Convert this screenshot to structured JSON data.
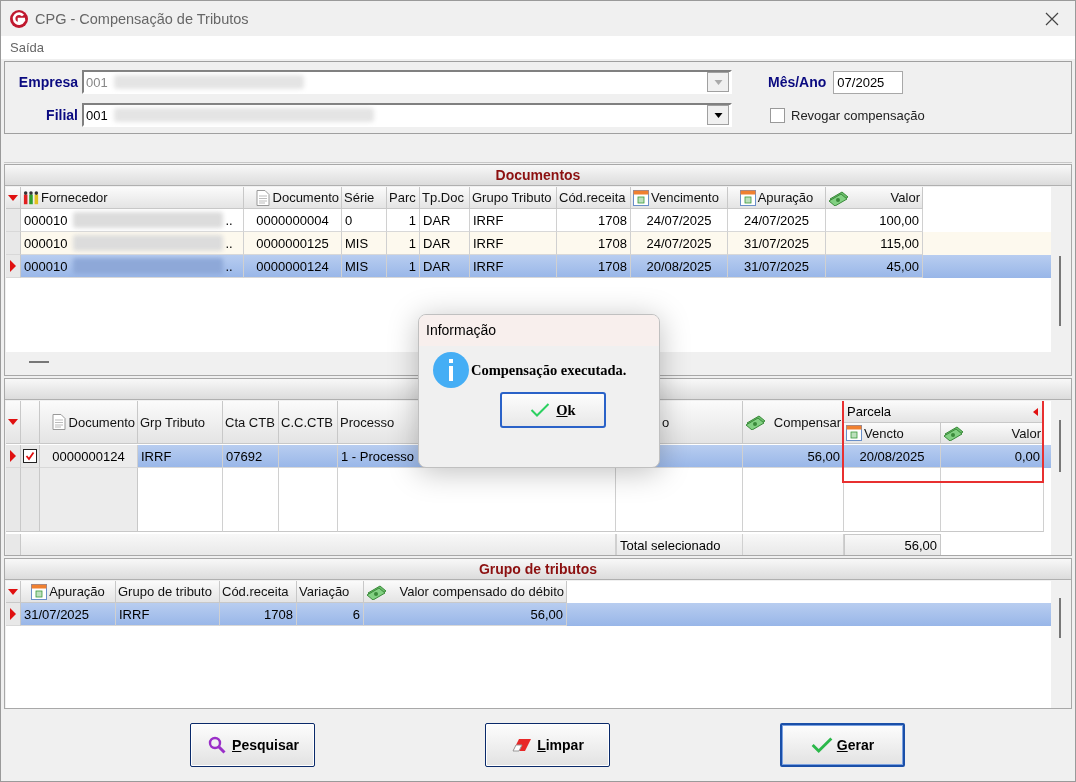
{
  "window": {
    "title": "CPG - Compensação de Tributos"
  },
  "menu": [
    "Saída"
  ],
  "filters": {
    "empresa": {
      "label": "Empresa",
      "value": "001",
      "disabled": true
    },
    "filial": {
      "label": "Filial",
      "value": "001",
      "disabled": false
    },
    "mes_ano": {
      "label": "Mês/Ano",
      "value": "07/2025"
    },
    "revogar": {
      "label": "Revogar compensação",
      "checked": false
    }
  },
  "documentos": {
    "title": "Documentos",
    "columns": [
      "Fornecedor",
      "Documento",
      "Série",
      "Parc",
      "Tp.Doc",
      "Grupo Tributo",
      "Cód.receita",
      "Vencimento",
      "Apuração",
      "Valor"
    ],
    "rows": [
      {
        "fornecedor": "000010",
        "fornecedor_tail": "..",
        "documento": "0000000004",
        "serie": "0",
        "parc": "1",
        "tp_doc": "DAR",
        "grupo_tributo": "IRRF",
        "cod_receita": "1708",
        "vencimento": "24/07/2025",
        "apuracao": "24/07/2025",
        "valor": "100,00",
        "selected": false
      },
      {
        "fornecedor": "000010",
        "fornecedor_tail": "..",
        "documento": "0000000125",
        "serie": "MIS",
        "parc": "1",
        "tp_doc": "DAR",
        "grupo_tributo": "IRRF",
        "cod_receita": "1708",
        "vencimento": "24/07/2025",
        "apuracao": "31/07/2025",
        "valor": "115,00",
        "selected": false
      },
      {
        "fornecedor": "000010",
        "fornecedor_tail": "..",
        "documento": "0000000124",
        "serie": "MIS",
        "parc": "1",
        "tp_doc": "DAR",
        "grupo_tributo": "IRRF",
        "cod_receita": "1708",
        "vencimento": "20/08/2025",
        "apuracao": "31/07/2025",
        "valor": "45,00",
        "selected": true
      }
    ]
  },
  "compensacao": {
    "columns": [
      "Documento",
      "Grp Tributo",
      "Cta CTB",
      "C.C.CTB",
      "Processo",
      "o",
      "Compensar"
    ],
    "group": {
      "title": "Parcela",
      "columns": [
        "Vencto",
        "Valor"
      ]
    },
    "rows": [
      {
        "documento": "0000000124",
        "grp_tributo": "IRRF",
        "cta_ctb": "07692",
        "processo": "1 - Processo",
        "compensar": "56,00",
        "vencto": "20/08/2025",
        "valor": "0,00",
        "checked": true,
        "selected": true
      }
    ],
    "total": {
      "label": "Total selecionado",
      "value": "56,00"
    }
  },
  "grupo_tributos": {
    "title": "Grupo de tributos",
    "columns": [
      "Apuração",
      "Grupo de tributo",
      "Cód.receita",
      "Variação",
      "Valor compensado do débito"
    ],
    "rows": [
      {
        "apuracao": "31/07/2025",
        "grupo": "IRRF",
        "cod_receita": "1708",
        "variacao": "6",
        "valor": "56,00",
        "selected": true
      }
    ]
  },
  "buttons": [
    {
      "label": "Pesquisar",
      "default": false
    },
    {
      "label": "Limpar",
      "default": false
    },
    {
      "label": "Gerar",
      "default": true
    }
  ],
  "dialog": {
    "title": "Informação",
    "message": "Compensação executada.",
    "button": "Ok"
  }
}
